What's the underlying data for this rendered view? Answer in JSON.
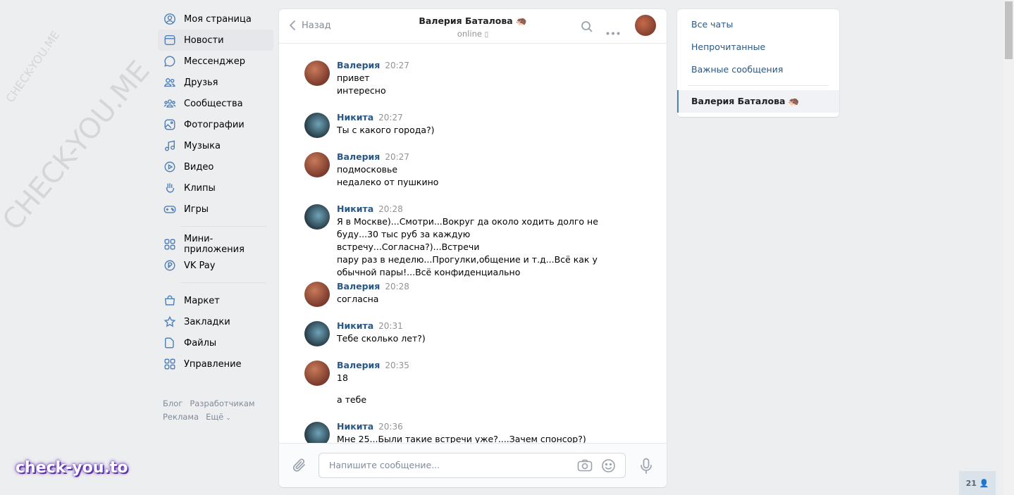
{
  "watermarks": {
    "small": "CHECK-YOU.ME",
    "large": "CHECK-YOU.ME",
    "bottom": "check-you.to"
  },
  "nav": {
    "items": [
      {
        "label": "Моя страница",
        "icon": "user-circle-icon"
      },
      {
        "label": "Новости",
        "icon": "news-icon"
      },
      {
        "label": "Мессенджер",
        "icon": "message-icon"
      },
      {
        "label": "Друзья",
        "icon": "friends-icon"
      },
      {
        "label": "Сообщества",
        "icon": "communities-icon"
      },
      {
        "label": "Фотографии",
        "icon": "photo-icon"
      },
      {
        "label": "Музыка",
        "icon": "music-icon"
      },
      {
        "label": "Видео",
        "icon": "video-icon"
      },
      {
        "label": "Клипы",
        "icon": "clips-icon"
      },
      {
        "label": "Игры",
        "icon": "gamepad-icon"
      }
    ],
    "items2": [
      {
        "label": "Мини-приложения",
        "icon": "apps-icon"
      },
      {
        "label": "VK Pay",
        "icon": "vkpay-icon"
      }
    ],
    "items3": [
      {
        "label": "Маркет",
        "icon": "market-icon"
      },
      {
        "label": "Закладки",
        "icon": "star-icon"
      },
      {
        "label": "Файлы",
        "icon": "file-icon"
      },
      {
        "label": "Управление",
        "icon": "manage-icon"
      }
    ],
    "footer": [
      "Блог",
      "Разработчикам",
      "Реклама",
      "Ещё"
    ]
  },
  "chat": {
    "back_label": "Назад",
    "peer_name": "Валерия Баталова 🦔",
    "peer_status": "online",
    "messages": [
      {
        "author": "Валерия",
        "time": "20:27",
        "lines": [
          "привет",
          "интересно"
        ]
      },
      {
        "author": "Никита",
        "time": "20:27",
        "lines": [
          "Ты с какого города?)"
        ]
      },
      {
        "author": "Валерия",
        "time": "20:27",
        "lines": [
          "подмосковье",
          "недалеко от пушкино"
        ]
      },
      {
        "author": "Никита",
        "time": "20:28",
        "lines": [
          "Я в Москве)...Смотри...Вокруг да около ходить долго не",
          "буду...30 тыс руб за каждую встречу...Согласна?)...Встречи",
          "пару раз в неделю...Прогулки,общение и т.д...Всё как у",
          "обычной пары!...Всё конфиденциально"
        ]
      },
      {
        "author": "Валерия",
        "time": "20:28",
        "lines": [
          "согласна"
        ]
      },
      {
        "author": "Никита",
        "time": "20:31",
        "lines": [
          "Тебе сколько лет?)"
        ]
      },
      {
        "author": "Валерия",
        "time": "20:35",
        "lines": [
          "18",
          "",
          "а тебе"
        ]
      },
      {
        "author": "Никита",
        "time": "20:36",
        "lines": [
          "Мне 25...Были такие встречи уже?....Зачем спонсор?)"
        ]
      }
    ],
    "input_placeholder": "Напишите сообщение..."
  },
  "side": {
    "all_chats": "Все чаты",
    "unread": "Непрочитанные",
    "important": "Важные сообщения",
    "active_chat": "Валерия Баталова 🦔"
  },
  "online_count": "21",
  "colors": {
    "link": "#2a5885",
    "bg": "#edeef0",
    "icon": "#5181b8"
  }
}
